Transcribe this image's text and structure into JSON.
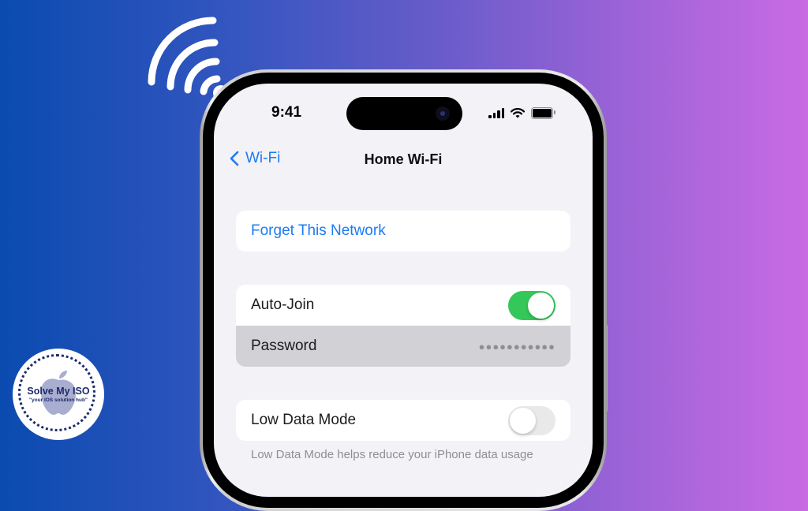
{
  "status_bar": {
    "time": "9:41",
    "signal_icon": "cellular-signal-icon",
    "wifi_icon": "wifi-icon",
    "battery_icon": "battery-icon"
  },
  "nav": {
    "back_label": "Wi-Fi",
    "back_icon": "chevron-left-icon",
    "title": "Home Wi-Fi"
  },
  "groups": {
    "forget": {
      "label": "Forget This Network"
    },
    "auto_join": {
      "label": "Auto-Join",
      "enabled": true
    },
    "password": {
      "label": "Password",
      "masked_value": "●●●●●●●●●●●"
    },
    "low_data": {
      "label": "Low Data Mode",
      "enabled": false,
      "footnote": "Low Data Mode helps reduce your iPhone data usage"
    }
  },
  "logo": {
    "title": "Solve My ISO",
    "tagline": "\"your IOS solution hub\""
  },
  "colors": {
    "accent_blue": "#1c7cf4",
    "toggle_green": "#34c759",
    "gradient_start": "#0a4bb0",
    "gradient_end": "#c96be3"
  }
}
